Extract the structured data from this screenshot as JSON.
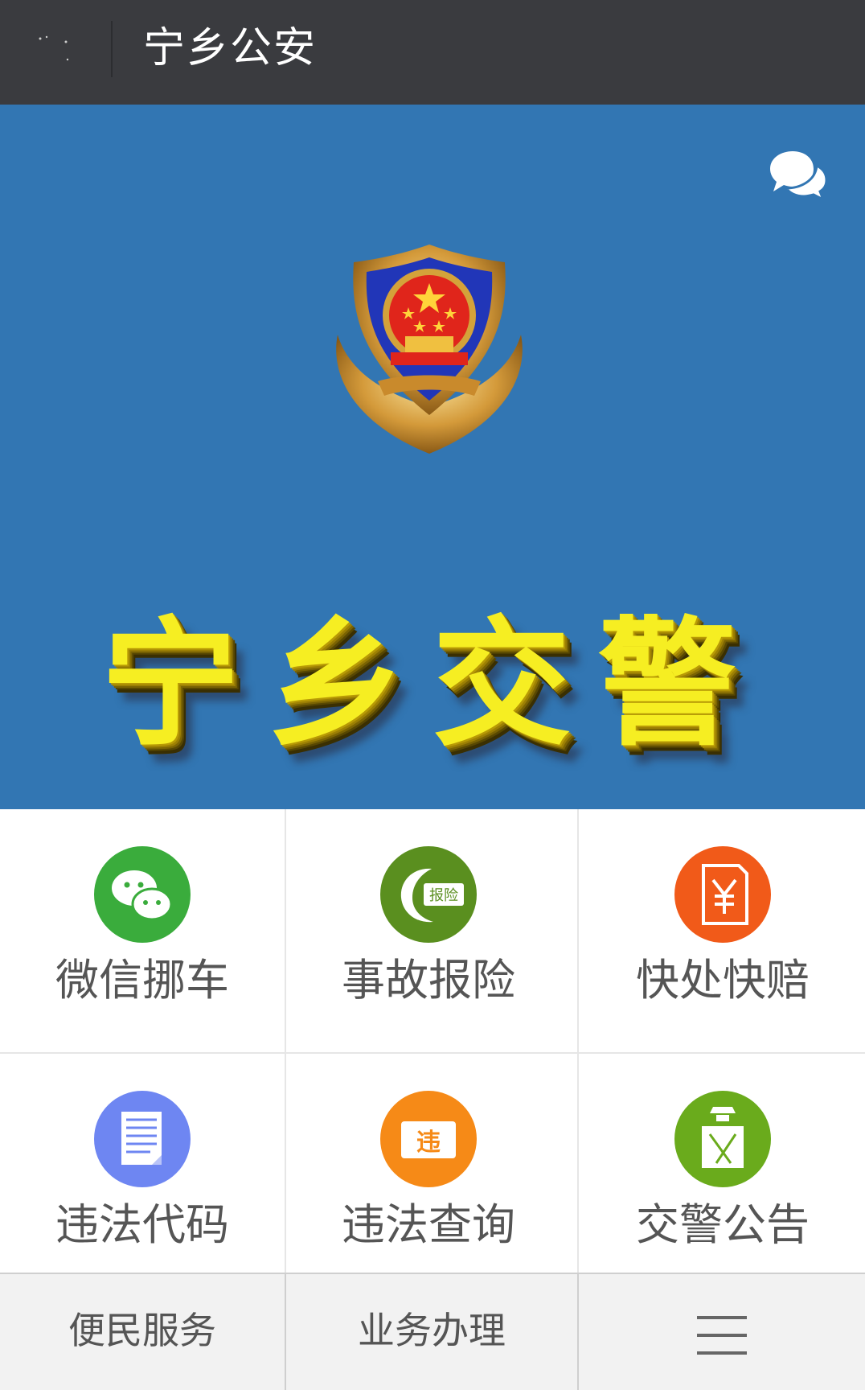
{
  "header": {
    "title": "宁乡公安"
  },
  "banner": {
    "title": "宁乡交警"
  },
  "grid": {
    "items": [
      {
        "label": "微信挪车",
        "icon": "wechat-icon",
        "color": "#3aac3c"
      },
      {
        "label": "事故报险",
        "icon": "accident-report-icon",
        "color": "#5a8f1f"
      },
      {
        "label": "快处快赔",
        "icon": "claim-receipt-icon",
        "color": "#f15a19"
      },
      {
        "label": "违法代码",
        "icon": "document-icon",
        "color": "#6e86f2"
      },
      {
        "label": "违法查询",
        "icon": "violation-query-icon",
        "color": "#f68a17"
      },
      {
        "label": "交警公告",
        "icon": "traffic-police-icon",
        "color": "#6aab1c"
      }
    ],
    "badge_text": "报险",
    "violation_char": "违"
  },
  "bottom_nav": {
    "tabs": [
      {
        "label": "便民服务"
      },
      {
        "label": "业务办理"
      },
      {
        "label": "",
        "icon": "menu-icon"
      }
    ]
  },
  "colors": {
    "topbar": "#3a3b3f",
    "banner": "#3276b3",
    "banner_text": "#f6ee22"
  }
}
